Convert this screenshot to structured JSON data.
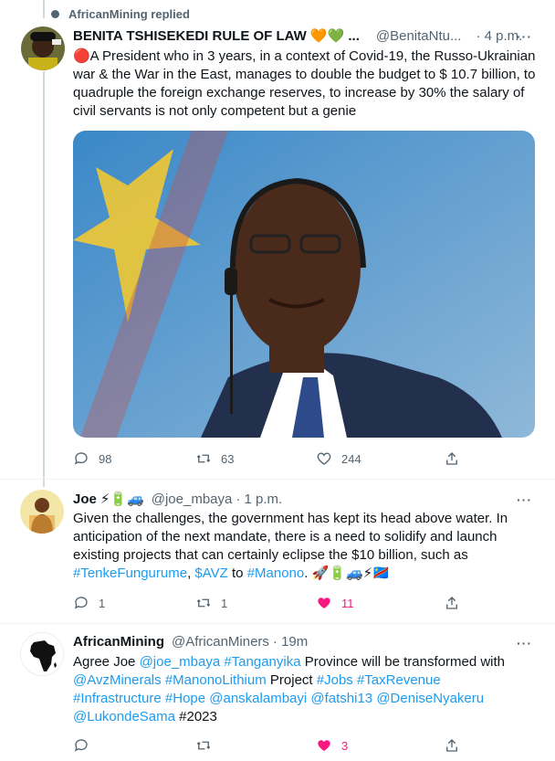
{
  "replied_banner": {
    "text": "AfricanMining replied"
  },
  "tweet1": {
    "name": "BENITA TSHISEKEDI RULE OF LAW",
    "name_emoji": "🧡💚 ...",
    "handle": "@BenitaNtu...",
    "time": "· 4 p.m.",
    "more": "···",
    "text": "🔴A President who in 3 years, in a context of Covid-19, the Russo-Ukrainian war & the War in the East, manages to double the budget to $ 10.7 billion, to quadruple the foreign exchange reserves, to increase by 30% the salary of civil servants is not only competent but a genie",
    "replies": "98",
    "retweets": "63",
    "likes": "244"
  },
  "tweet2": {
    "name": "Joe",
    "name_emoji": "⚡🔋🚙",
    "handle": "@joe_mbaya",
    "time": "· 1 p.m.",
    "more": "···",
    "text_part1": "Given the challenges, the government has kept its head above water. In anticipation of the next mandate, there is a need to solidify and launch existing projects that can certainly eclipse the $10 billion, such as",
    "tag1": "#TenkeFungurume",
    "sep1": ",",
    "tag2": "$AVZ",
    "word_to": "to",
    "tag3": "#Manono",
    "trailing": ". 🚀🔋🚙⚡🇨🇩",
    "replies": "1",
    "retweets": "1",
    "likes": "11"
  },
  "tweet3": {
    "name": "AfricanMining",
    "handle": "@AfricanMiners",
    "time": "· 19m",
    "more": "···",
    "t_agree": "Agree Joe",
    "m_joe": "@joe_mbaya",
    "h_tanganyika": "#Tanganyika",
    "t_province": "Province will be transformed with",
    "m_avz": "@AvzMinerals",
    "h_manono": "#ManonoLithium",
    "t_project": "Project",
    "h_jobs": "#Jobs",
    "h_tax": "#TaxRevenue",
    "h_infra": "#Infrastructure",
    "h_hope": "#Hope",
    "m_anska": "@anskalambayi",
    "m_fatshi": "@fatshi13",
    "m_denise": "@DeniseNyakeru",
    "m_lukonde": "@LukondeSama",
    "t_2023": "#2023",
    "likes": "3"
  },
  "colors": {
    "accent": "#1d9bf0",
    "like_active": "#f91880",
    "muted": "#536471",
    "line": "#cfd9de"
  }
}
